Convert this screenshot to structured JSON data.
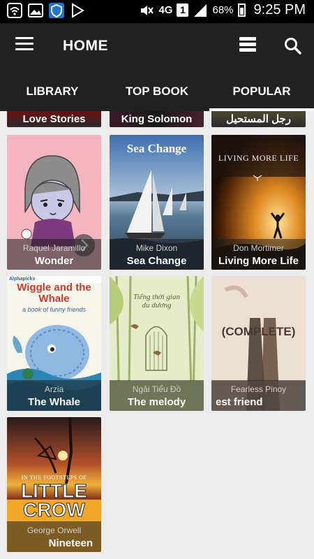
{
  "status_bar": {
    "network": "4G",
    "sim": "1",
    "battery": "68%",
    "time": "9:25 PM"
  },
  "app_bar": {
    "title": "HOME"
  },
  "tabs": [
    {
      "label": "LIBRARY"
    },
    {
      "label": "TOP BOOK"
    },
    {
      "label": "POPULAR"
    }
  ],
  "partial_row": [
    {
      "title": "Love Stories"
    },
    {
      "title": "King Solomon"
    },
    {
      "title": "رجل المستحيل"
    }
  ],
  "books": [
    {
      "author": "Raquel Jaramillo",
      "title": "Wonder"
    },
    {
      "author": "Mike Dixon",
      "title": "Sea Change",
      "cover_text": "Sea Change"
    },
    {
      "author": "Don Mortimer",
      "title": "Living More Life",
      "cover_text": "LIVING MORE LIFE"
    },
    {
      "author": "Arzia",
      "title": "The Whale",
      "cover_text": "Wiggle and the Whale",
      "cover_subtext": "a book of funny friends",
      "cover_tag": "Alphapicks"
    },
    {
      "author": "Ngải Tiểu Đồ",
      "title": "The melody",
      "cover_text": "Tiếng thời gian du dương"
    },
    {
      "author": "Fearless Pinoy",
      "title": "est friend",
      "cover_text": "(COMPLETE)"
    },
    {
      "author": "George Orwell",
      "title": "Nineteen",
      "cover_text": "LITTLE CROW",
      "cover_subtext": "IN THE FOOTSTEPS OF"
    }
  ]
}
